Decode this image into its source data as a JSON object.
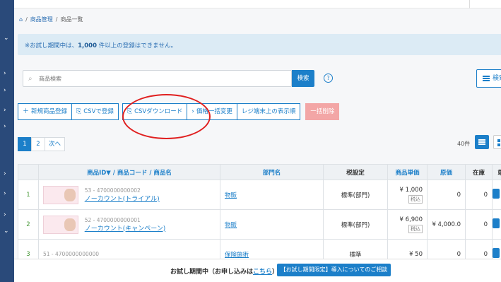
{
  "breadcrumb": {
    "home_icon": "home-icon",
    "items": [
      "商品管理",
      "商品一覧"
    ],
    "separator": "/"
  },
  "notice": {
    "prefix": "※お試し期間中は、",
    "bold": "1,000",
    "suffix": "件以上の登録はできません。"
  },
  "search": {
    "placeholder": "商品検索",
    "button_label": "検索",
    "help_label": "?",
    "detail_label": "検索"
  },
  "actions": {
    "new_product": "新規商品登録",
    "csv_register": "CSVで登録",
    "csv_download": "CSVダウンロード",
    "bulk_price": "価格一括変更",
    "register_display": "レジ端末上の表示順",
    "bulk_delete": "一括削除"
  },
  "pagination": {
    "pages": [
      "1",
      "2"
    ],
    "next": "次へ",
    "active_page": "1"
  },
  "count_label": "40件",
  "table": {
    "headers": {
      "product": "商品ID▼ / 商品コード / 商品名",
      "dept": "部門名",
      "tax": "税設定",
      "unit_price": "商品単価",
      "cost": "原価",
      "stock": "在庫",
      "terminal": "端末"
    },
    "rows": [
      {
        "no": "1",
        "code": "53 - 4700000000002",
        "name": "ノーカウント(トライアル)",
        "dept": "物販",
        "tax": "標準(部門)",
        "price": "¥ 1,000",
        "price_tax": "税込",
        "cost": "0",
        "stock": "0"
      },
      {
        "no": "2",
        "code": "52 - 4700000000001",
        "name": "ノーカウント(キャンペーン)",
        "dept": "物販",
        "tax": "標準(部門)",
        "price": "¥ 6,900",
        "price_tax": "税込",
        "cost": "¥ 4,000.0",
        "stock": "0"
      },
      {
        "no": "3",
        "code": "51 - 4700000000000",
        "name": "",
        "dept": "保険施術",
        "tax": "標準",
        "price": "¥ 50",
        "price_tax": "",
        "cost": "0",
        "stock": "0"
      }
    ]
  },
  "footer": {
    "text_prefix": "お試し期間中（お申し込みは",
    "link": "こちら",
    "text_suffix": "）",
    "cta": "【お試し期間限定】導入についてのご相談"
  },
  "colors": {
    "sidebar": "#2a4a7a",
    "accent": "#1c7fc9",
    "notice_bg": "#dcebf5",
    "danger": "#f3a6a6",
    "annotation_circle": "#e02020"
  }
}
